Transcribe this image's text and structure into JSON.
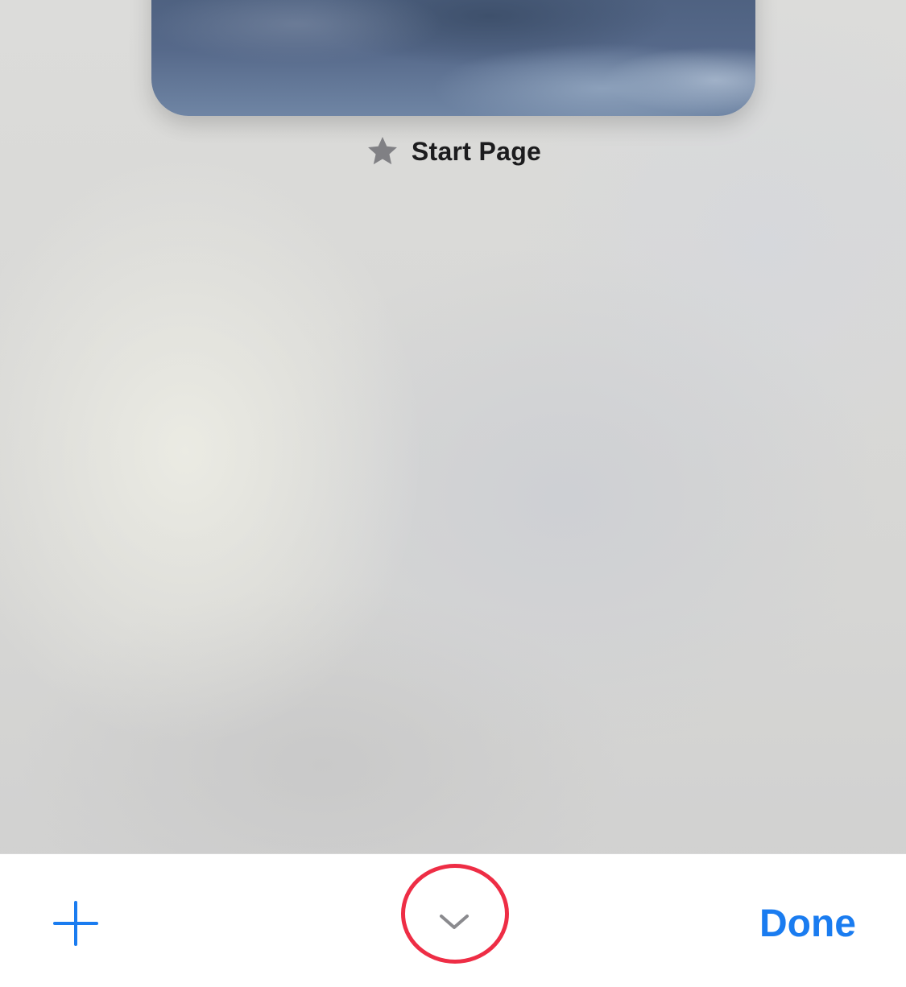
{
  "tab": {
    "title": "Start Page",
    "icon": "star-icon",
    "icon_color": "#808084"
  },
  "toolbar": {
    "add_icon": "plus-icon",
    "collapse_icon": "chevron-down-icon",
    "done_label": "Done",
    "accent_color": "#1a7cf0",
    "highlight_color": "#ee2d45"
  }
}
